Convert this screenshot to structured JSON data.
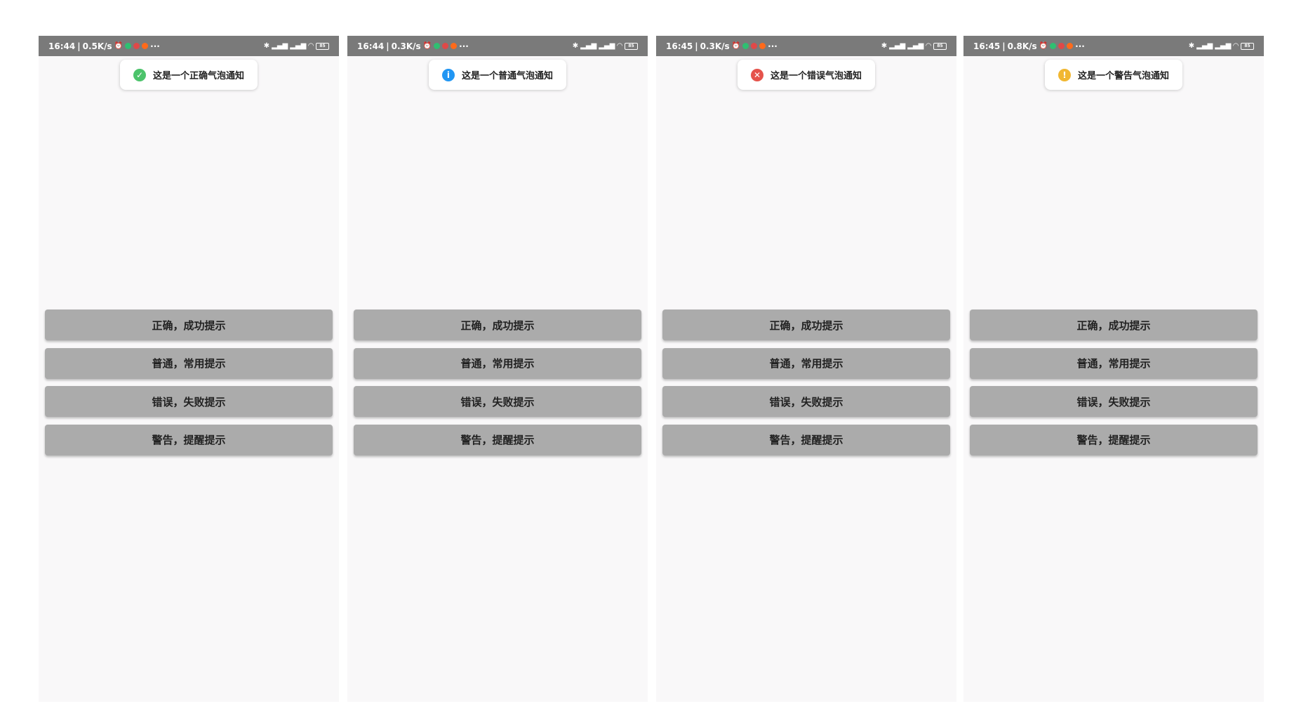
{
  "colors": {
    "success": "#4cc36b",
    "info": "#2196f3",
    "error": "#e5534b",
    "warning": "#f1b731",
    "statusbar": "#7a7a7a",
    "screen": "#f9f8f9",
    "button": "#ababab"
  },
  "buttons": {
    "success_label": "正确，成功提示",
    "info_label": "普通，常用提示",
    "error_label": "错误，失败提示",
    "warning_label": "警告，提醒提示"
  },
  "screens": [
    {
      "status": {
        "time": "16:44",
        "speed": "0.5K/s",
        "more": "···",
        "battery": "85"
      },
      "toast": {
        "type": "success",
        "icon": "check-circle-icon",
        "symbol": "✓",
        "text": "这是一个正确气泡通知"
      }
    },
    {
      "status": {
        "time": "16:44",
        "speed": "0.3K/s",
        "more": "···",
        "battery": "85"
      },
      "toast": {
        "type": "info",
        "icon": "info-circle-icon",
        "symbol": "i",
        "text": "这是一个普通气泡通知"
      }
    },
    {
      "status": {
        "time": "16:45",
        "speed": "0.3K/s",
        "more": "···",
        "battery": "85"
      },
      "toast": {
        "type": "error",
        "icon": "error-circle-icon",
        "symbol": "✕",
        "text": "这是一个错误气泡通知"
      }
    },
    {
      "status": {
        "time": "16:45",
        "speed": "0.8K/s",
        "more": "···",
        "battery": "85"
      },
      "toast": {
        "type": "warning",
        "icon": "warning-circle-icon",
        "symbol": "!",
        "text": "这是一个警告气泡通知"
      }
    }
  ]
}
